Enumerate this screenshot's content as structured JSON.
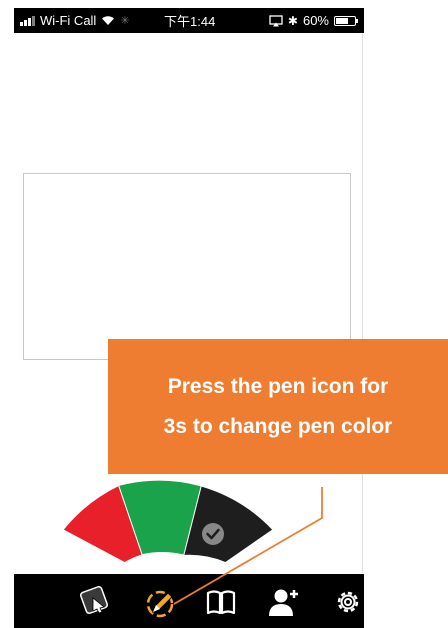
{
  "status_bar": {
    "carrier": "Wi-Fi Call",
    "time": "下午1:44",
    "battery": "60%",
    "battery_level": 0.6
  },
  "pen_colors": [
    {
      "name": "red",
      "color": "#e8202a"
    },
    {
      "name": "green",
      "color": "#1aa34a"
    },
    {
      "name": "black",
      "color": "#1e1e1e",
      "selected": true
    }
  ],
  "toolbar": {
    "items": [
      "touch-icon",
      "pen-icon",
      "book-icon",
      "add-user-icon",
      "gear-icon"
    ],
    "icon_color": "#ffffff",
    "pen_icon_color": "#f5a623"
  },
  "callout": {
    "line1": "Press the pen icon for",
    "line2": "3s to change pen color",
    "color": "#ee7d31"
  }
}
